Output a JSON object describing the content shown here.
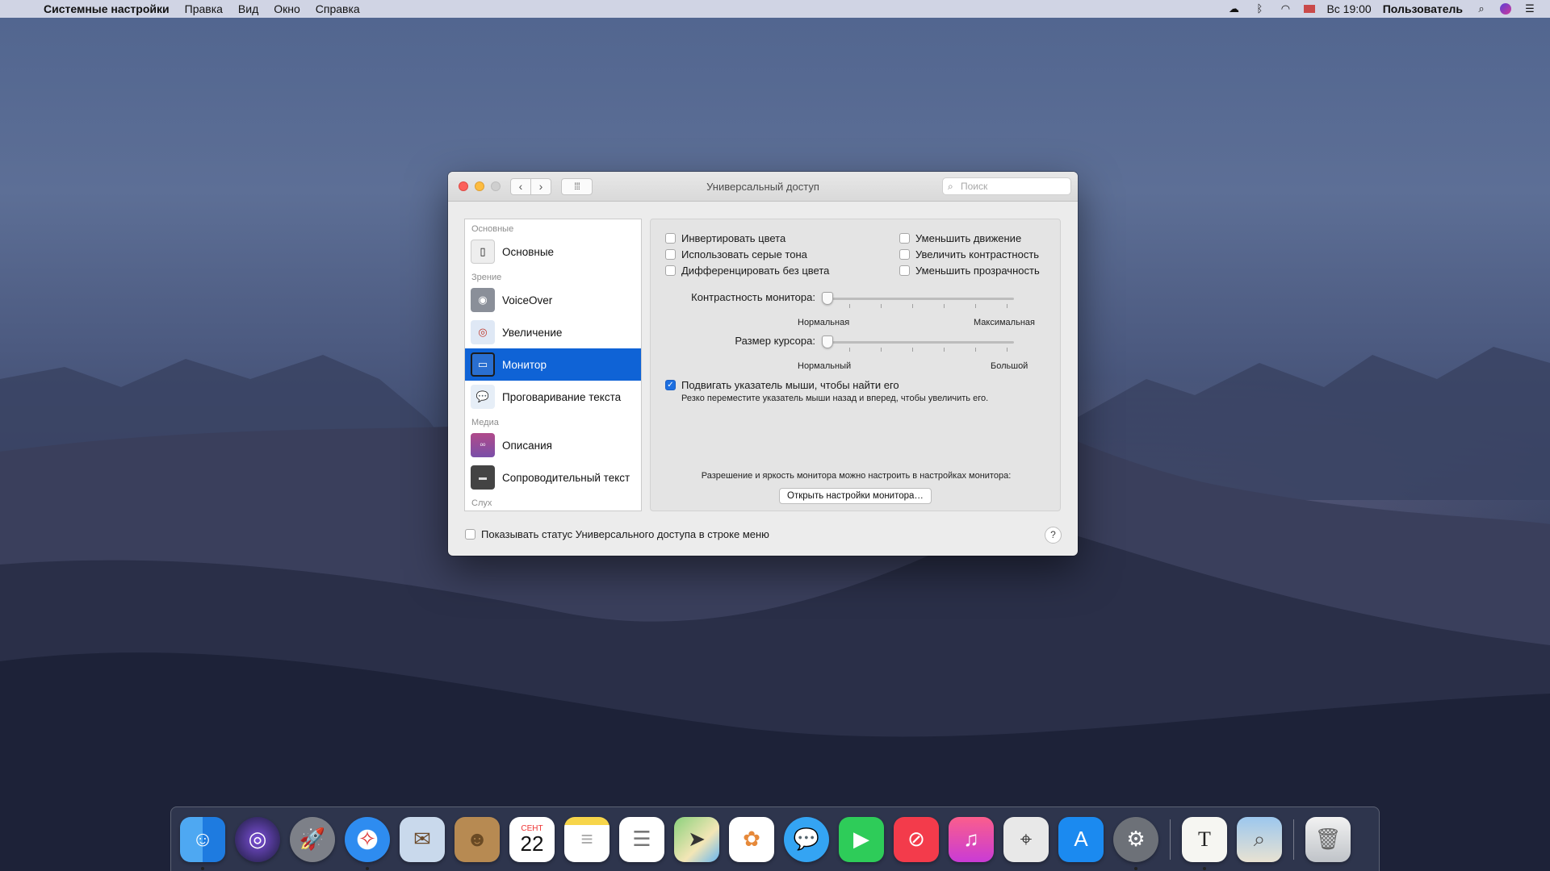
{
  "menubar": {
    "app_name": "Системные настройки",
    "menus": [
      "Правка",
      "Вид",
      "Окно",
      "Справка"
    ],
    "clock": "Вс 19:00",
    "user": "Пользователь"
  },
  "window": {
    "title": "Универсальный доступ",
    "search_placeholder": "Поиск",
    "sidebar": {
      "section_main": "Основные",
      "item_main": "Основные",
      "section_vision": "Зрение",
      "item_voiceover": "VoiceOver",
      "item_zoom": "Увеличение",
      "item_display": "Монитор",
      "item_speech": "Проговаривание текста",
      "section_media": "Медиа",
      "item_descriptions": "Описания",
      "item_captions": "Сопроводительный текст",
      "section_hearing": "Слух"
    },
    "options": {
      "invert": "Инвертировать цвета",
      "grayscale": "Использовать серые тона",
      "differentiate": "Дифференцировать без цвета",
      "reduce_motion": "Уменьшить движение",
      "increase_contrast": "Увеличить контрастность",
      "reduce_transparency": "Уменьшить прозрачность"
    },
    "contrast": {
      "label": "Контрастность монитора:",
      "min_label": "Нормальная",
      "max_label": "Максимальная",
      "value": 0
    },
    "cursor": {
      "label": "Размер курсора:",
      "min_label": "Нормальный",
      "max_label": "Большой",
      "value": 0
    },
    "shake": {
      "label": "Подвигать указатель мыши, чтобы найти его",
      "description": "Резко переместите указатель мыши назад и вперед, чтобы увеличить его.",
      "checked": true
    },
    "display_note": "Разрешение и яркость монитора можно настроить в настройках монитора:",
    "open_display_button": "Открыть настройки монитора…",
    "show_status_label": "Показывать статус Универсального доступа в строке меню",
    "help": "?"
  },
  "dock": {
    "calendar_month": "СЕНТ",
    "calendar_day": "22",
    "textedit_letter": "T"
  }
}
